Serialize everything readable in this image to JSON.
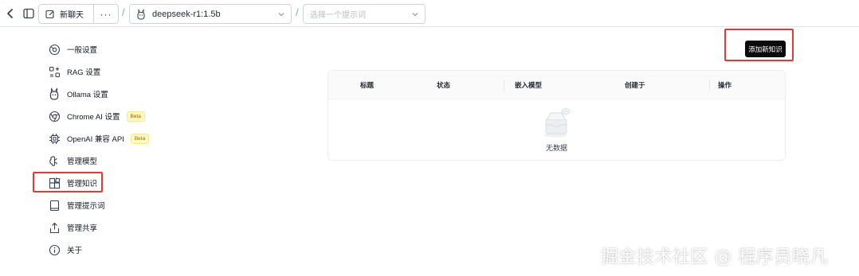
{
  "header": {
    "new_chat_label": "新聊天",
    "more_label": "···",
    "separator": "/",
    "model_value": "deepseek-r1:1.5b",
    "prompt_placeholder": "选择一个提示词"
  },
  "sidebar": {
    "items": [
      {
        "label": "一般设置",
        "icon": "gear-icon"
      },
      {
        "label": "RAG 设置",
        "icon": "rag-icon"
      },
      {
        "label": "Ollama 设置",
        "icon": "ollama-icon"
      },
      {
        "label": "Chrome AI 设置",
        "icon": "chrome-icon",
        "badge": "Beta"
      },
      {
        "label": "OpenAI 兼容 API",
        "icon": "chip-icon",
        "badge": "Beta"
      },
      {
        "label": "管理模型",
        "icon": "brain-icon"
      },
      {
        "label": "管理知识",
        "icon": "blocks-icon"
      },
      {
        "label": "管理提示词",
        "icon": "book-icon"
      },
      {
        "label": "管理共享",
        "icon": "share-icon"
      },
      {
        "label": "关于",
        "icon": "info-icon"
      }
    ]
  },
  "main": {
    "add_button_label": "添加新知识",
    "table": {
      "columns": [
        "标题",
        "状态",
        "嵌入模型",
        "创建于",
        "操作"
      ],
      "empty_text": "无数据"
    }
  },
  "watermark": "掘金技术社区 @ 程序员晓凡",
  "colors": {
    "highlight": "#e53935",
    "primary_button": "#0b0b0b",
    "beta_bg": "#fef9c3"
  }
}
